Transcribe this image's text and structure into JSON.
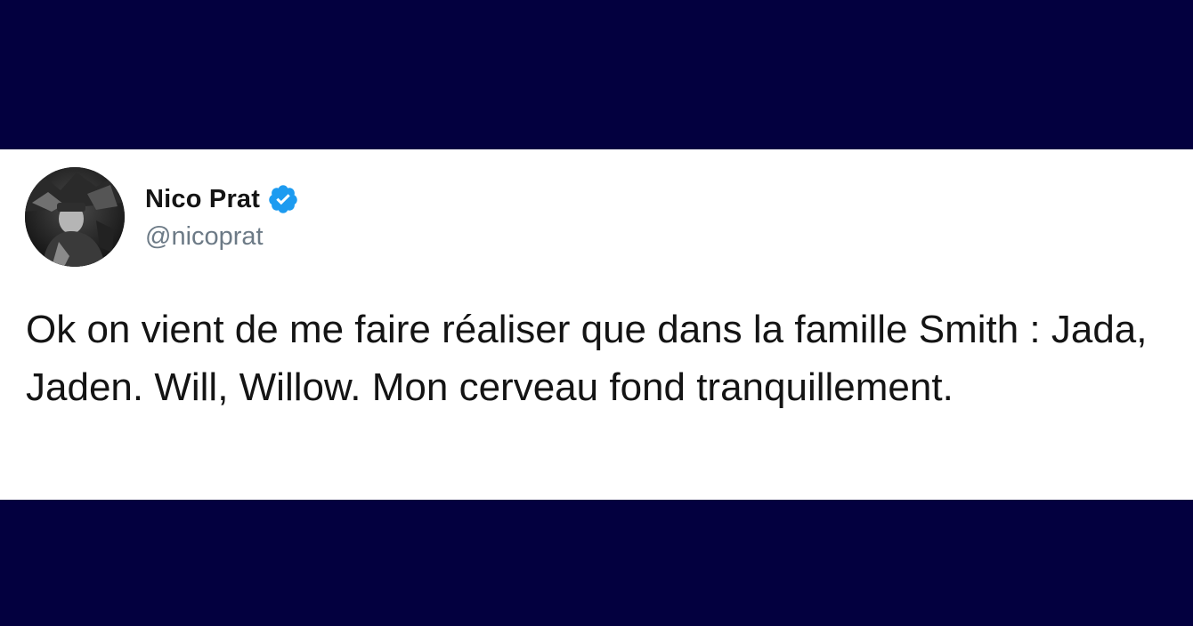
{
  "tweet": {
    "author": {
      "display_name": "Nico Prat",
      "handle": "@nicoprat",
      "verified": true,
      "avatar_icon": "profile-photo"
    },
    "text": "Ok on vient de me faire réaliser que dans la famille Smith : Jada, Jaden. Will, Willow. Mon cerveau fond tranquillement."
  },
  "colors": {
    "background": "#03003f",
    "card": "#ffffff",
    "verified_badge": "#1d9bf0",
    "handle": "#6c7a86",
    "text": "#141414"
  }
}
